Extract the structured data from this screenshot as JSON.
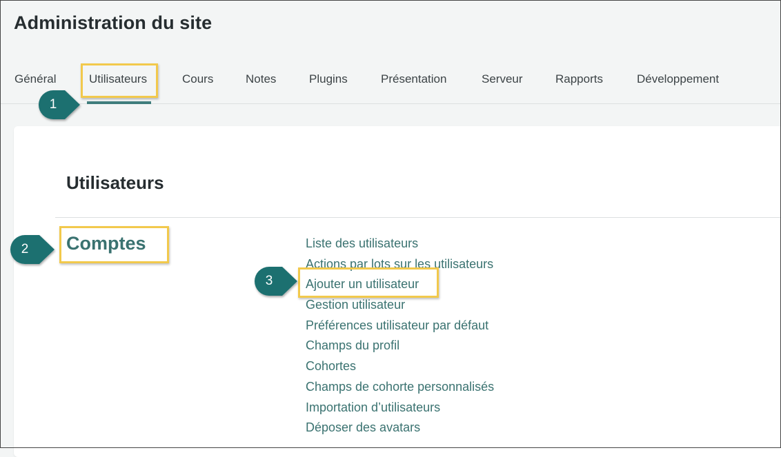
{
  "header": {
    "title": "Administration du site"
  },
  "tabs": [
    {
      "label": "Général"
    },
    {
      "label": "Utilisateurs"
    },
    {
      "label": "Cours"
    },
    {
      "label": "Notes"
    },
    {
      "label": "Plugins"
    },
    {
      "label": "Présentation"
    },
    {
      "label": "Serveur"
    },
    {
      "label": "Rapports"
    },
    {
      "label": "Développement"
    }
  ],
  "active_tab": "Utilisateurs",
  "main": {
    "heading": "Utilisateurs",
    "category": {
      "title": "Comptes",
      "links": [
        "Liste des utilisateurs",
        "Actions par lots sur les utilisateurs",
        "Ajouter un utilisateur",
        "Gestion utilisateur",
        "Préférences utilisateur par défaut",
        "Champs du profil",
        "Cohortes",
        "Champs de cohorte personnalisés",
        "Importation d’utilisateurs",
        "Déposer des avatars"
      ]
    }
  },
  "callouts": [
    {
      "number": "1"
    },
    {
      "number": "2"
    },
    {
      "number": "3"
    }
  ],
  "colors": {
    "accent": "#3f7d7c",
    "link": "#3a7270",
    "highlight": "#f2c94c",
    "callout": "#1e6f70"
  }
}
